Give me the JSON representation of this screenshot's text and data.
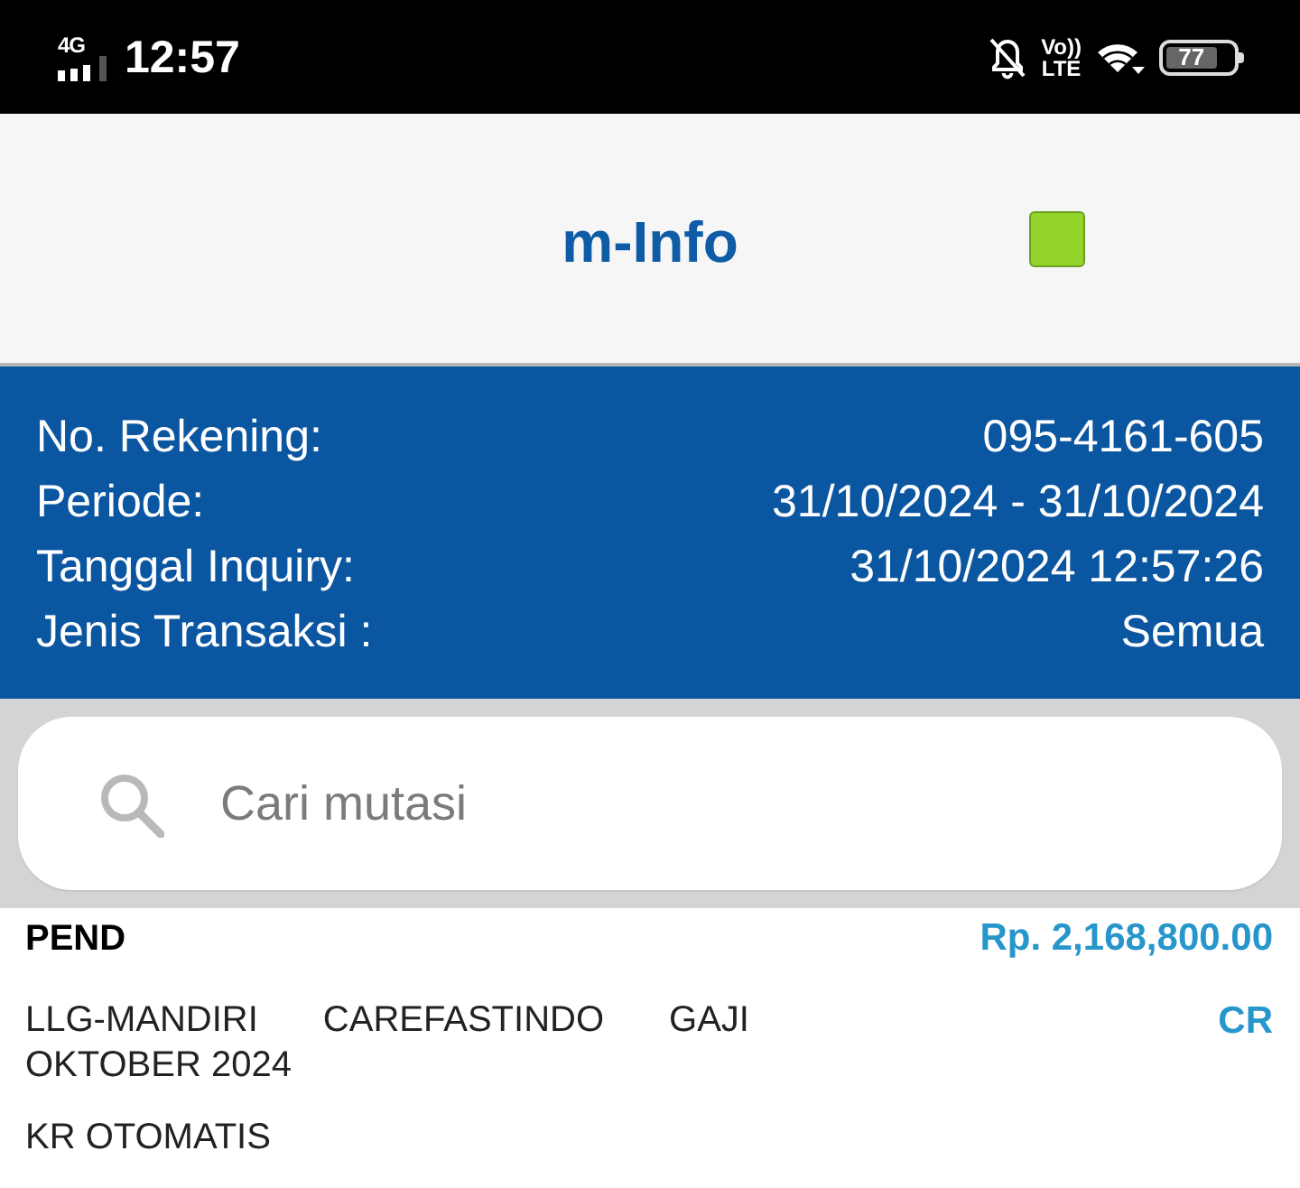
{
  "status_bar": {
    "network": "4G",
    "time": "12:57",
    "volte": [
      "Vo))",
      "LTE"
    ],
    "battery": "77"
  },
  "app_bar": {
    "title": "m-Info"
  },
  "account_info": [
    {
      "label": "No. Rekening:",
      "value": "095-4161-605"
    },
    {
      "label": "Periode:",
      "value": "31/10/2024 - 31/10/2024"
    },
    {
      "label": "Tanggal Inquiry:",
      "value": "31/10/2024 12:57:26"
    },
    {
      "label": "Jenis Transaksi :",
      "value": "Semua"
    }
  ],
  "search": {
    "placeholder": "Cari mutasi"
  },
  "transactions": [
    {
      "status": "PEND",
      "amount": "Rp. 2,168,800.00",
      "description": "LLG-MANDIRI CAREFASTINDO GAJI OKTOBER 2024",
      "type": "CR",
      "note": "KR OTOMATIS"
    }
  ]
}
